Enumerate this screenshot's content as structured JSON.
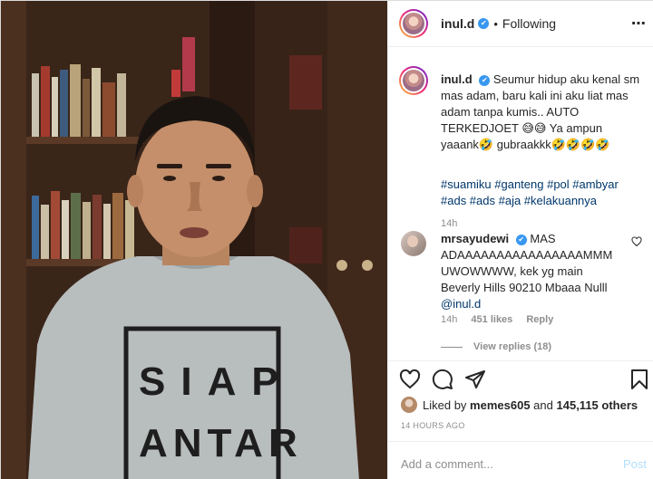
{
  "post": {
    "username": "inul.d",
    "verified_mark": "✔",
    "separator": "•",
    "follow_status": "Following",
    "more_icon": "⋯",
    "photo_shirt_line1": "SIAP",
    "photo_shirt_line2": "ANTAR"
  },
  "caption": {
    "username": "inul.d",
    "text": "Seumur hidup aku kenal sm mas adam, baru kali ini aku liat mas adam tanpa kumis.. AUTO TERKEDJOET 😅😅 Ya ampun yaaank🤣 gubraakkk🤣🤣🤣🤣",
    "hashtags": "#suamiku #ganteng #pol #ambyar #ads #ads #aja #kelakuannya",
    "time": "14h"
  },
  "reply": {
    "username": "mrsayudewi",
    "text": "MAS ADAAAAAAAAAAAAAAAAMMM UWOWWWW, kek yg main Beverly Hills 90210 Mbaaa Nulll",
    "mention": "@inul.d",
    "time": "14h",
    "likes": "451 likes",
    "reply_label": "Reply",
    "view_replies": "View replies (18)"
  },
  "likes_line": {
    "prefix": "Liked by",
    "user": "memes605",
    "and": "and",
    "count": "145,115 others"
  },
  "post_time": "14 HOURS AGO",
  "comment_box": {
    "placeholder": "Add a comment...",
    "post_label": "Post"
  },
  "colors": {
    "accent": "#3897f0",
    "link": "#00376b",
    "muted": "#8e8e8e"
  }
}
